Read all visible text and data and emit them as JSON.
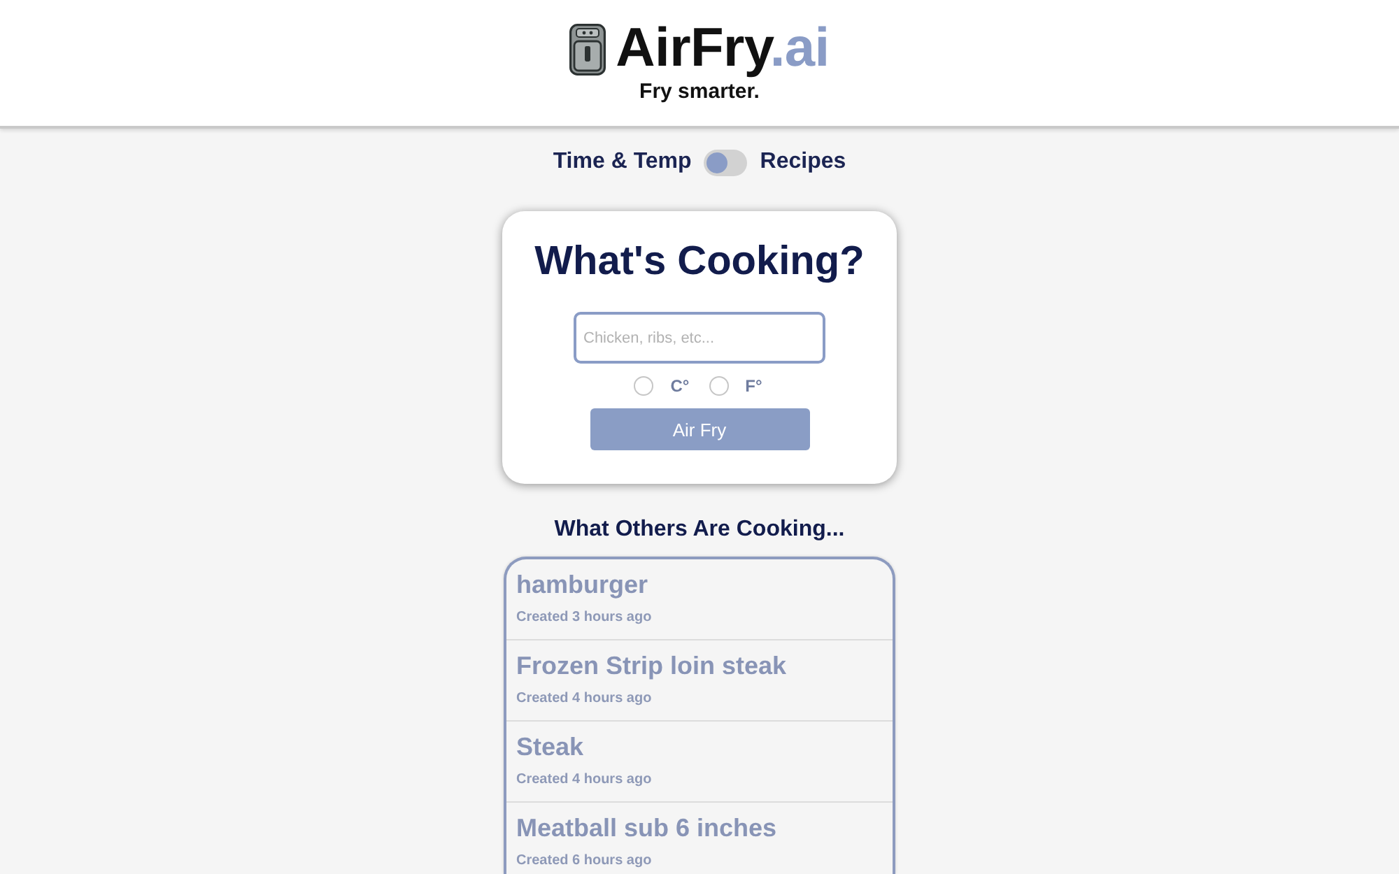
{
  "header": {
    "logo": {
      "name": "AirFry",
      "suffix": ".ai"
    },
    "tagline": "Fry smarter."
  },
  "mode_toggle": {
    "left_label": "Time & Temp",
    "on": false,
    "right_label": "Recipes"
  },
  "search_card": {
    "title": "What's Cooking?",
    "input": {
      "placeholder": "Chicken, ribs, etc..."
    },
    "units": [
      {
        "label": "C°",
        "selected": false
      },
      {
        "label": "F°",
        "selected": false
      }
    ],
    "button": "Air Fry"
  },
  "recent": {
    "title": "What Others Are Cooking...",
    "items": [
      {
        "title": "hamburger",
        "meta": "Created 3 hours ago"
      },
      {
        "title": "Frozen Strip loin steak",
        "meta": "Created 4 hours ago"
      },
      {
        "title": "Steak",
        "meta": "Created 4 hours ago"
      },
      {
        "title": "Meatball sub 6 inches",
        "meta": "Created 6 hours ago"
      }
    ]
  }
}
